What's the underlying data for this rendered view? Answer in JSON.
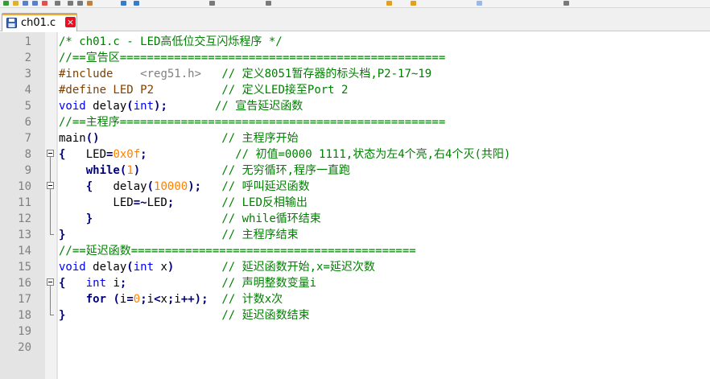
{
  "tab": {
    "filename": "ch01.c",
    "close": "×"
  },
  "colors": {
    "comment": "#008000",
    "keyword": "#0000ff",
    "number": "#ff8000",
    "preprocessor": "#804000",
    "current_line": "#e8e8ff",
    "tab_accent": "#f5a623"
  },
  "icons": [
    "save-icon",
    "close-icon",
    "fold-box-icon"
  ],
  "lines": [
    {
      "n": "1",
      "t": [
        [
          "c",
          "/* ch01.c - LED高低位交互闪烁程序 */"
        ]
      ]
    },
    {
      "n": "2",
      "t": [
        [
          "c",
          "//==宣告区================================================"
        ]
      ]
    },
    {
      "n": "3",
      "t": [
        [
          "pp",
          "#include    "
        ],
        [
          "str",
          "<reg51.h>"
        ],
        [
          "p",
          "   "
        ],
        [
          "c",
          "// 定义8051暂存器的标头档,P2-17~19"
        ]
      ]
    },
    {
      "n": "4",
      "t": [
        [
          "pp",
          "#define LED P2"
        ],
        [
          "p",
          "          "
        ],
        [
          "c",
          "// 定义LED接至Port 2"
        ]
      ]
    },
    {
      "n": "5",
      "t": [
        [
          "kw",
          "void"
        ],
        [
          "p",
          " delay"
        ],
        [
          "op",
          "("
        ],
        [
          "kw",
          "int"
        ],
        [
          "op",
          ");"
        ],
        [
          "p",
          "       "
        ],
        [
          "c",
          "// 宣告延迟函数"
        ]
      ]
    },
    {
      "n": "6",
      "t": [
        [
          "c",
          "//==主程序================================================"
        ]
      ]
    },
    {
      "n": "7",
      "t": [
        [
          "p",
          "main"
        ],
        [
          "op",
          "()"
        ],
        [
          "p",
          "                  "
        ],
        [
          "c",
          "// 主程序开始"
        ]
      ]
    },
    {
      "n": "8",
      "t": [
        [
          "op",
          "{"
        ],
        [
          "p",
          "   LED"
        ],
        [
          "op",
          "="
        ],
        [
          "num",
          "0x0f"
        ],
        [
          "op",
          ";"
        ],
        [
          "p",
          "             "
        ],
        [
          "c",
          "// 初值=0000 1111,状态为左4个亮,右4个灭(共阳)"
        ]
      ]
    },
    {
      "n": "9",
      "t": [
        [
          "p",
          "    "
        ],
        [
          "kwb",
          "while"
        ],
        [
          "op",
          "("
        ],
        [
          "num",
          "1"
        ],
        [
          "op",
          ")"
        ],
        [
          "p",
          "            "
        ],
        [
          "c",
          "// 无穷循环,程序一直跑"
        ]
      ]
    },
    {
      "n": "10",
      "t": [
        [
          "p",
          "    "
        ],
        [
          "op",
          "{"
        ],
        [
          "p",
          "   delay"
        ],
        [
          "op",
          "("
        ],
        [
          "num",
          "10000"
        ],
        [
          "op",
          ");"
        ],
        [
          "p",
          "   "
        ],
        [
          "c",
          "// 呼叫延迟函数"
        ]
      ]
    },
    {
      "n": "11",
      "t": [
        [
          "p",
          "        LED"
        ],
        [
          "op",
          "=~"
        ],
        [
          "p",
          "LED"
        ],
        [
          "op",
          ";"
        ],
        [
          "p",
          "       "
        ],
        [
          "c",
          "// LED反相输出"
        ]
      ]
    },
    {
      "n": "12",
      "t": [
        [
          "p",
          "    "
        ],
        [
          "op",
          "}"
        ],
        [
          "p",
          "                   "
        ],
        [
          "c",
          "// while循环结束"
        ]
      ]
    },
    {
      "n": "13",
      "t": [
        [
          "op",
          "}"
        ],
        [
          "p",
          "                       "
        ],
        [
          "c",
          "// 主程序结束"
        ]
      ]
    },
    {
      "n": "14",
      "t": [
        [
          "c",
          "//==延迟函数=========================================="
        ]
      ]
    },
    {
      "n": "15",
      "t": [
        [
          "kw",
          "void"
        ],
        [
          "p",
          " delay"
        ],
        [
          "op",
          "("
        ],
        [
          "kw",
          "int"
        ],
        [
          "p",
          " x"
        ],
        [
          "op",
          ")"
        ],
        [
          "p",
          "       "
        ],
        [
          "c",
          "// 延迟函数开始,x=延迟次数"
        ]
      ]
    },
    {
      "n": "16",
      "t": [
        [
          "op",
          "{"
        ],
        [
          "p",
          "   "
        ],
        [
          "kw",
          "int"
        ],
        [
          "p",
          " i"
        ],
        [
          "op",
          ";"
        ],
        [
          "p",
          "              "
        ],
        [
          "c",
          "// 声明整数变量i"
        ]
      ]
    },
    {
      "n": "17",
      "t": [
        [
          "p",
          "    "
        ],
        [
          "kwb",
          "for"
        ],
        [
          "p",
          " "
        ],
        [
          "op",
          "("
        ],
        [
          "p",
          "i"
        ],
        [
          "op",
          "="
        ],
        [
          "num",
          "0"
        ],
        [
          "op",
          ";"
        ],
        [
          "p",
          "i"
        ],
        [
          "op",
          "<"
        ],
        [
          "p",
          "x"
        ],
        [
          "op",
          ";"
        ],
        [
          "p",
          "i"
        ],
        [
          "op",
          "++);"
        ],
        [
          "p",
          "  "
        ],
        [
          "c",
          "// 计数x次"
        ]
      ]
    },
    {
      "n": "18",
      "t": [
        [
          "op",
          "}"
        ],
        [
          "p",
          "                       "
        ],
        [
          "c",
          "// 延迟函数结束"
        ]
      ]
    },
    {
      "n": "19",
      "t": []
    },
    {
      "n": "20",
      "t": []
    }
  ]
}
